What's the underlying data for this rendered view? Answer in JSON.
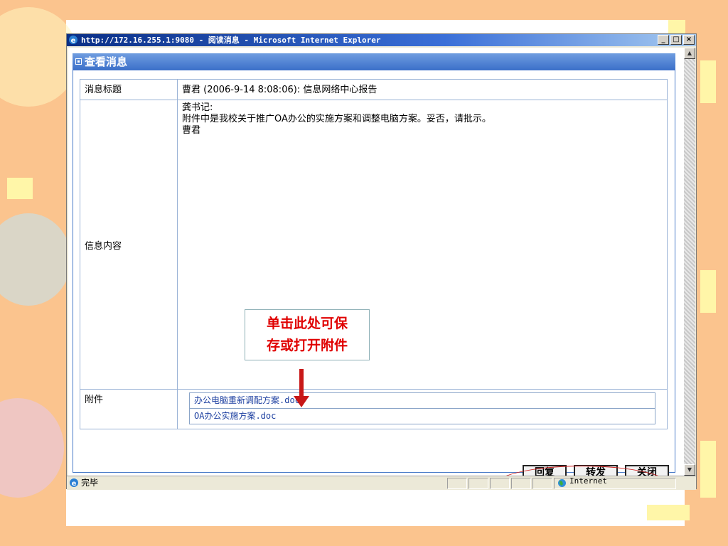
{
  "window": {
    "title": "http://172.16.255.1:9080 - 阅读消息 - Microsoft Internet Explorer",
    "minimize": "_",
    "maximize": "□",
    "close": "×"
  },
  "panel": {
    "title": "查看消息"
  },
  "message": {
    "subject_label": "消息标题",
    "subject": "曹君 (2006-9-14 8:08:06): 信息网络中心报告",
    "content_label": "信息内容",
    "content_lines": [
      "龚书记:",
      "附件中是我校关于推广OA办公的实施方案和调整电脑方案。妥否，请批示。",
      "曹君"
    ],
    "attachments_label": "附件",
    "attachments": [
      "办公电脑重新调配方案.doc",
      "OA办公实施方案.doc"
    ]
  },
  "callout": {
    "line1": "单击此处可保",
    "line2": "存或打开附件"
  },
  "buttons": {
    "reply": "回复",
    "forward": "转发",
    "close": "关闭"
  },
  "status": {
    "text": "完毕",
    "zone": "Internet"
  },
  "colors": {
    "slide_bg": "#fbc48e",
    "titlebar": "#0a2f86",
    "panel_header": "#3b6fc9",
    "callout_text": "#e00000",
    "arrow": "#c81818"
  }
}
